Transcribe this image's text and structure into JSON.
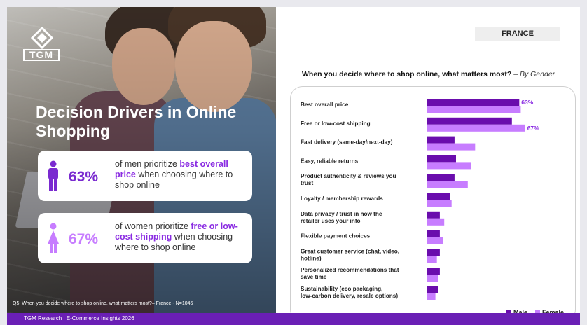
{
  "country": "FRANCE",
  "logo_text": "TGM",
  "hero_title": "Decision Drivers in Online Shopping",
  "men_stat": {
    "percent": "63%",
    "text_before": "of men prioritize ",
    "highlight": "best overall price",
    "text_after": " when choosing where to shop online"
  },
  "women_stat": {
    "percent": "67%",
    "text_before": "of women prioritize ",
    "highlight": "free or low-cost shipping",
    "text_after": " when choosing where to shop online"
  },
  "footnote": "Q5. When you decide where to shop online, what matters most?– France - N=1046",
  "footer": "TGM Research | E-Commerce Insights 2026",
  "question_bold": "When you decide where to shop online, what matters most?",
  "question_suffix": " – By Gender",
  "colors": {
    "male": "#6a0dad",
    "female": "#c77dff",
    "brand": "#6a1fb5"
  },
  "chart_data": {
    "type": "bar",
    "orientation": "horizontal",
    "categories": [
      "Best overall price",
      "Free or low-cost shipping",
      "Fast delivery (same-day/next-day)",
      "Easy, reliable returns",
      "Product authenticity & reviews you trust",
      "Loyalty / membership rewards",
      "Data privacy / trust in how the retailer uses your info",
      "Flexible payment choices",
      "Great customer service (chat, video, hotline)",
      "Personalized recommendations that save time",
      "Sustainability (eco packaging, low-carbon delivery, resale options)"
    ],
    "series": [
      {
        "name": "Male",
        "values": [
          63,
          58,
          19,
          20,
          19,
          16,
          9,
          9,
          9,
          9,
          8
        ]
      },
      {
        "name": "Female",
        "values": [
          64,
          67,
          33,
          30,
          28,
          17,
          12,
          11,
          7,
          8,
          6
        ]
      }
    ],
    "value_labels": [
      {
        "category": "Best overall price",
        "series": "Male",
        "text": "63%"
      },
      {
        "category": "Free or low-cost shipping",
        "series": "Female",
        "text": "67%"
      }
    ],
    "xlim": [
      0,
      100
    ],
    "grid": false,
    "legend": "bottom-right"
  }
}
